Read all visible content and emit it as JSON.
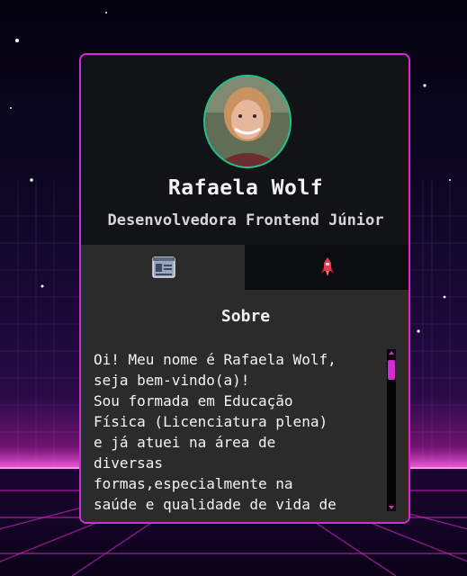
{
  "profile": {
    "name": "Rafaela Wolf",
    "role": "Desenvolvedora Frontend Júnior"
  },
  "tabs": [
    {
      "icon": "id-card-icon",
      "active": true
    },
    {
      "icon": "rocket-icon",
      "active": false
    }
  ],
  "about": {
    "title": "Sobre",
    "text": "Oi! Meu nome é Rafaela Wolf,\nseja bem-vindo(a)!\nSou formada em Educação\nFísica (Licenciatura plena)\ne já atuei na área de\ndiversas\nformas,especialmente na\nsaúde e qualidade de vida de"
  },
  "colors": {
    "accent": "#d52bd4",
    "avatar_border": "#1ec58f",
    "card_bg": "#121317",
    "panel_bg": "#2b2b2b"
  }
}
